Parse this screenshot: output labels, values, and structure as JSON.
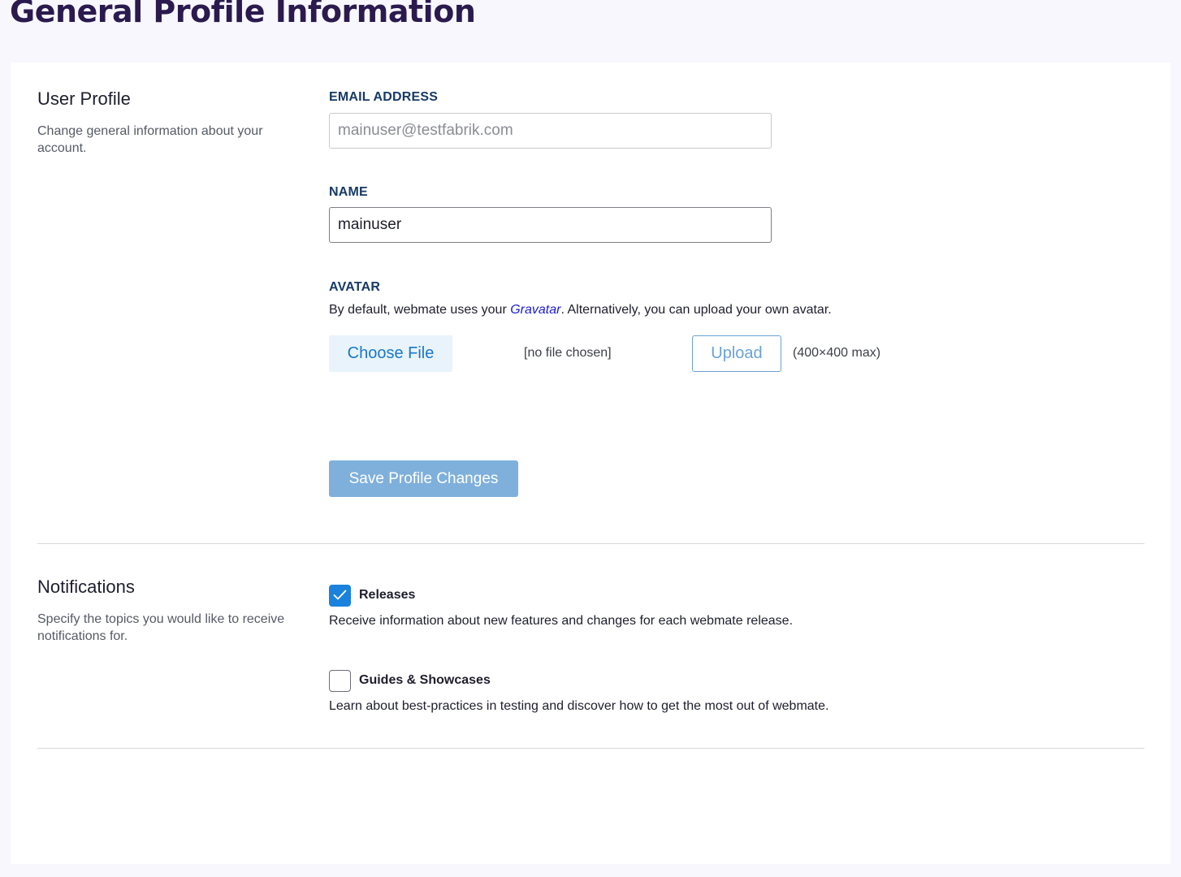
{
  "page": {
    "title": "General Profile Information"
  },
  "user_profile": {
    "title": "User Profile",
    "description": "Change general information about your account.",
    "email": {
      "label": "EMAIL ADDRESS",
      "value": "mainuser@testfabrik.com"
    },
    "name": {
      "label": "NAME",
      "value": "mainuser"
    },
    "avatar": {
      "label": "AVATAR",
      "desc_before": "By default, webmate uses your ",
      "link_text": "Gravatar",
      "desc_after": ". Alternatively, you can upload your own avatar.",
      "choose_file_label": "Choose File",
      "no_file_text": "[no file chosen]",
      "upload_label": "Upload",
      "size_hint": "(400×400 max)"
    },
    "save_label": "Save Profile Changes"
  },
  "notifications": {
    "title": "Notifications",
    "description": "Specify the topics you would like to receive notifications for.",
    "items": [
      {
        "label": "Releases",
        "description": "Receive information about new features and changes for each webmate release.",
        "checked": true
      },
      {
        "label": "Guides & Showcases",
        "description": "Learn about best-practices in testing and discover how to get the most out of webmate.",
        "checked": false
      }
    ]
  },
  "colors": {
    "title": "#2a1a4e",
    "label": "#173a66",
    "accent": "#1a82dc",
    "save_button": "#7fb0dc"
  }
}
